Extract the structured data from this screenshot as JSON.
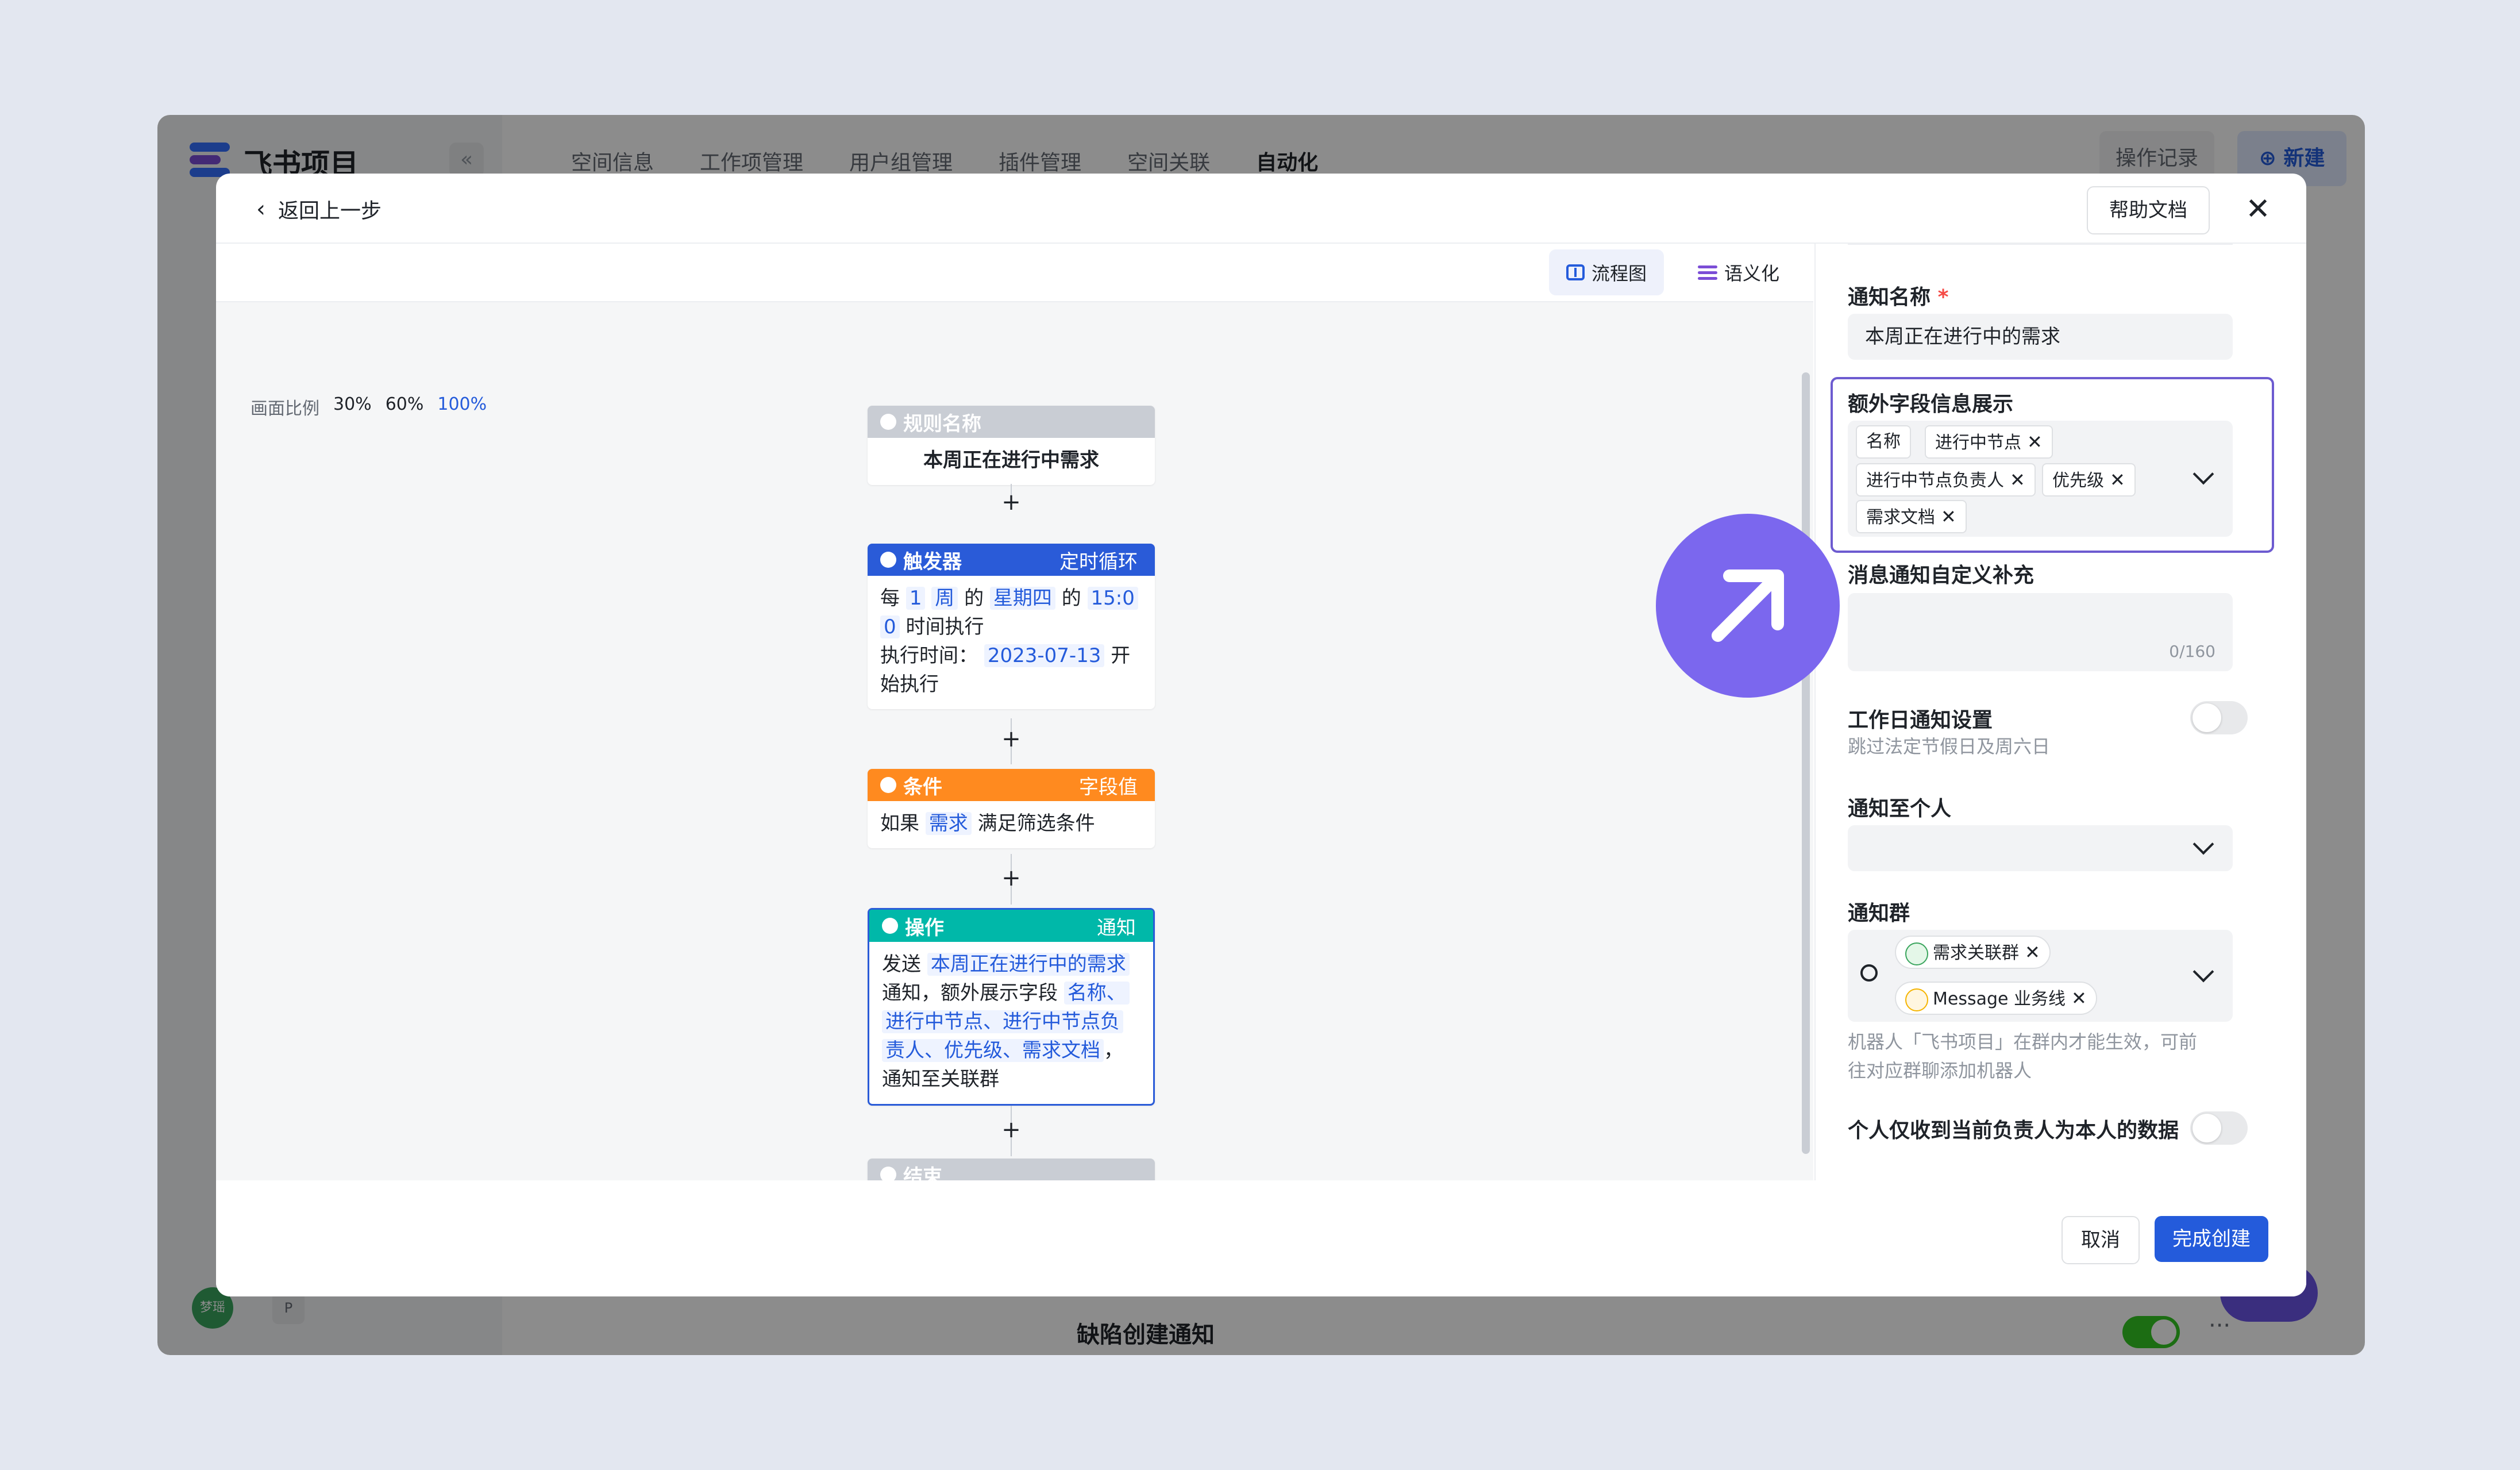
{
  "background_app": {
    "logo_text": "飞书项目",
    "collapse_glyph": "«",
    "nav_tabs": [
      "空间信息",
      "工作项管理",
      "用户组管理",
      "插件管理",
      "空间关联",
      "自动化"
    ],
    "active_tab": "自动化",
    "oplog_label": "操作记录",
    "new_label": "新建",
    "row_label": "缺陷创建通知",
    "row_more": "···",
    "avatar_text": "梦瑶",
    "p_badge": "P"
  },
  "modal": {
    "back_label": "返回上一步",
    "help_doc_label": "帮助文档",
    "close_glyph": "✕",
    "view_switch": {
      "flow": "流程图",
      "semantic": "语义化"
    },
    "zoom": {
      "label": "画面比例",
      "options": [
        "30%",
        "60%",
        "100%"
      ],
      "active": "100%"
    },
    "flow": {
      "rule_node": {
        "header": "规则名称",
        "body": "本周正在进行中需求"
      },
      "trigger_node": {
        "header": "触发器",
        "tag": "定时循环",
        "t1": "每",
        "v1": "1",
        "v2": "周",
        "t2": "的",
        "v3": "星期四",
        "t3": "的",
        "v4a": "15:0",
        "v4b": "0",
        "t4": "时间执行",
        "t5": "执行时间：",
        "v5": "2023-07-13",
        "t6a": "开",
        "t6b": "始执行"
      },
      "condition_node": {
        "header": "条件",
        "tag": "字段值",
        "t1": "如果",
        "v1": "需求",
        "t2": "满足筛选条件"
      },
      "action_node": {
        "header": "操作",
        "tag": "通知",
        "t1": "发送",
        "v1": "本周正在进行中的需求",
        "t2": "通知，额外展示字段",
        "v2": "名称、",
        "v3": "进行中节点、进行中节点负",
        "v4": "责人、优先级、需求文档",
        "t3": "，",
        "t4": "通知至关联群"
      },
      "end_node": {
        "header": "结束"
      },
      "plus": "+"
    },
    "panel": {
      "name_label": "通知名称",
      "required_mark": "*",
      "name_value": "本周正在进行中的需求",
      "extra_label": "额外字段信息展示",
      "extra_tags": [
        "名称",
        "进行中节点",
        "进行中节点负责人",
        "优先级",
        "需求文档"
      ],
      "tag_close": "✕",
      "custom_label": "消息通知自定义补充",
      "custom_counter": "0/160",
      "workday_label": "工作日通知设置",
      "workday_hint": "跳过法定节假日及周六日",
      "workday_on": false,
      "personal_label": "通知至个人",
      "group_label": "通知群",
      "group_tags": [
        "需求关联群",
        "Message 业务线"
      ],
      "group_hint_1": "机器人「飞书项目」在群内才能生效，可前",
      "group_hint_2": "往对应群聊添加机器人",
      "self_only_label": "个人仅收到当前负责人为本人的数据",
      "self_only_on": false
    },
    "footer": {
      "cancel": "取消",
      "finish": "完成创建"
    }
  },
  "colors": {
    "brand_blue": "#245bdb",
    "trigger_header": "#2a5bd8",
    "condition_header": "#ff8a1f",
    "action_header": "#00b8a9",
    "neutral_header": "#c9cdd4",
    "focus_border": "#6d5bd0",
    "cursor_circle": "#7b67ee"
  }
}
